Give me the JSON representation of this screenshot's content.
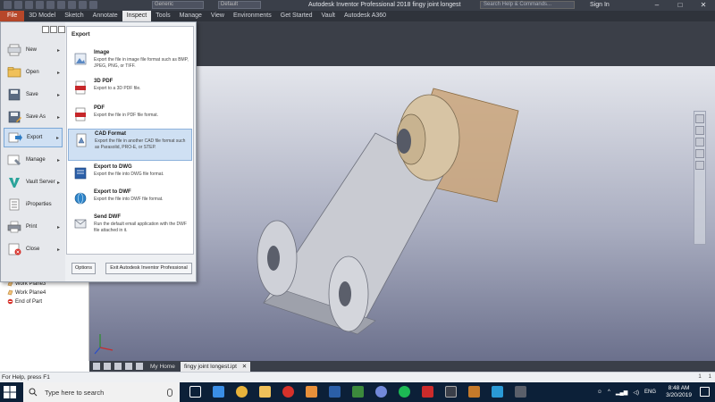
{
  "title_bar": {
    "app_title": "Autodesk Inventor Professional 2018   fingy joint longest",
    "style_select": "Default",
    "material_select": "Generic",
    "search_placeholder": "Search Help & Commands...",
    "sign_in": "Sign In",
    "minimize": "–",
    "maximize": "□",
    "close": "✕"
  },
  "ribbon_tabs": [
    "File",
    "3D Model",
    "Sketch",
    "Annotate",
    "Inspect",
    "Tools",
    "Manage",
    "View",
    "Environments",
    "Get Started",
    "Vault",
    "Autodesk A360"
  ],
  "active_tab": "Inspect",
  "file_menu": {
    "items": [
      {
        "label": "New",
        "icon": "new-file-icon",
        "arrow": "▸"
      },
      {
        "label": "Open",
        "icon": "open-folder-icon",
        "arrow": "▸"
      },
      {
        "label": "Save",
        "icon": "save-icon",
        "arrow": "▸"
      },
      {
        "label": "Save As",
        "icon": "save-as-icon",
        "arrow": "▸"
      },
      {
        "label": "Export",
        "icon": "export-icon",
        "arrow": "▸"
      },
      {
        "label": "Manage",
        "icon": "manage-icon",
        "arrow": "▸"
      },
      {
        "label": "Vault Server",
        "icon": "vault-icon",
        "arrow": "▸"
      },
      {
        "label": "iProperties",
        "icon": "iproperties-icon",
        "arrow": ""
      },
      {
        "label": "Print",
        "icon": "print-icon",
        "arrow": "▸"
      },
      {
        "label": "Close",
        "icon": "close-doc-icon",
        "arrow": "▸"
      }
    ],
    "selected": "Export",
    "submenu_title": "Export",
    "export_options": [
      {
        "title": "Image",
        "desc": "Export the file in image file format such as BMP, JPEG, PNG, or TIFF.",
        "icon": "image-export-icon"
      },
      {
        "title": "3D PDF",
        "desc": "Export to a 3D PDF file.",
        "icon": "3d-pdf-icon"
      },
      {
        "title": "PDF",
        "desc": "Export the file in PDF file format.",
        "icon": "pdf-icon"
      },
      {
        "title": "CAD Format",
        "desc": "Export the file in another CAD file format such as Parasolid, PRO-E, or STEP.",
        "icon": "cad-format-icon"
      },
      {
        "title": "Export to DWG",
        "desc": "Export the file into DWG file format.",
        "icon": "dwg-icon"
      },
      {
        "title": "Export to DWF",
        "desc": "Export the file into DWF file format.",
        "icon": "dwf-icon"
      },
      {
        "title": "Send DWF",
        "desc": "Run the default email application with the DWF file attached in it.",
        "icon": "send-dwf-icon"
      }
    ],
    "selected_option": "CAD Format",
    "options_button": "Options",
    "exit_button": "Exit Autodesk Inventor Professional"
  },
  "browser_tree": [
    {
      "label": "Work Plane3",
      "icon": "work-plane-icon"
    },
    {
      "label": "Work Plane4",
      "icon": "work-plane-icon"
    },
    {
      "label": "End of Part",
      "icon": "end-of-part-icon"
    }
  ],
  "doc_tabs": {
    "home": "My Home",
    "active": "fingy joint longest.ipt",
    "close": "✕"
  },
  "status_bar": {
    "help_text": "For Help, press F1",
    "count_a": "1",
    "count_b": "1"
  },
  "taskbar": {
    "search_placeholder": "Type here to search",
    "language": "ENG",
    "time": "8:48 AM",
    "date": "3/20/2019"
  },
  "colors": {
    "accent_file_tab": "#b7472a",
    "selection_blue": "#cfe0f3",
    "taskbar": "#0c2038"
  }
}
